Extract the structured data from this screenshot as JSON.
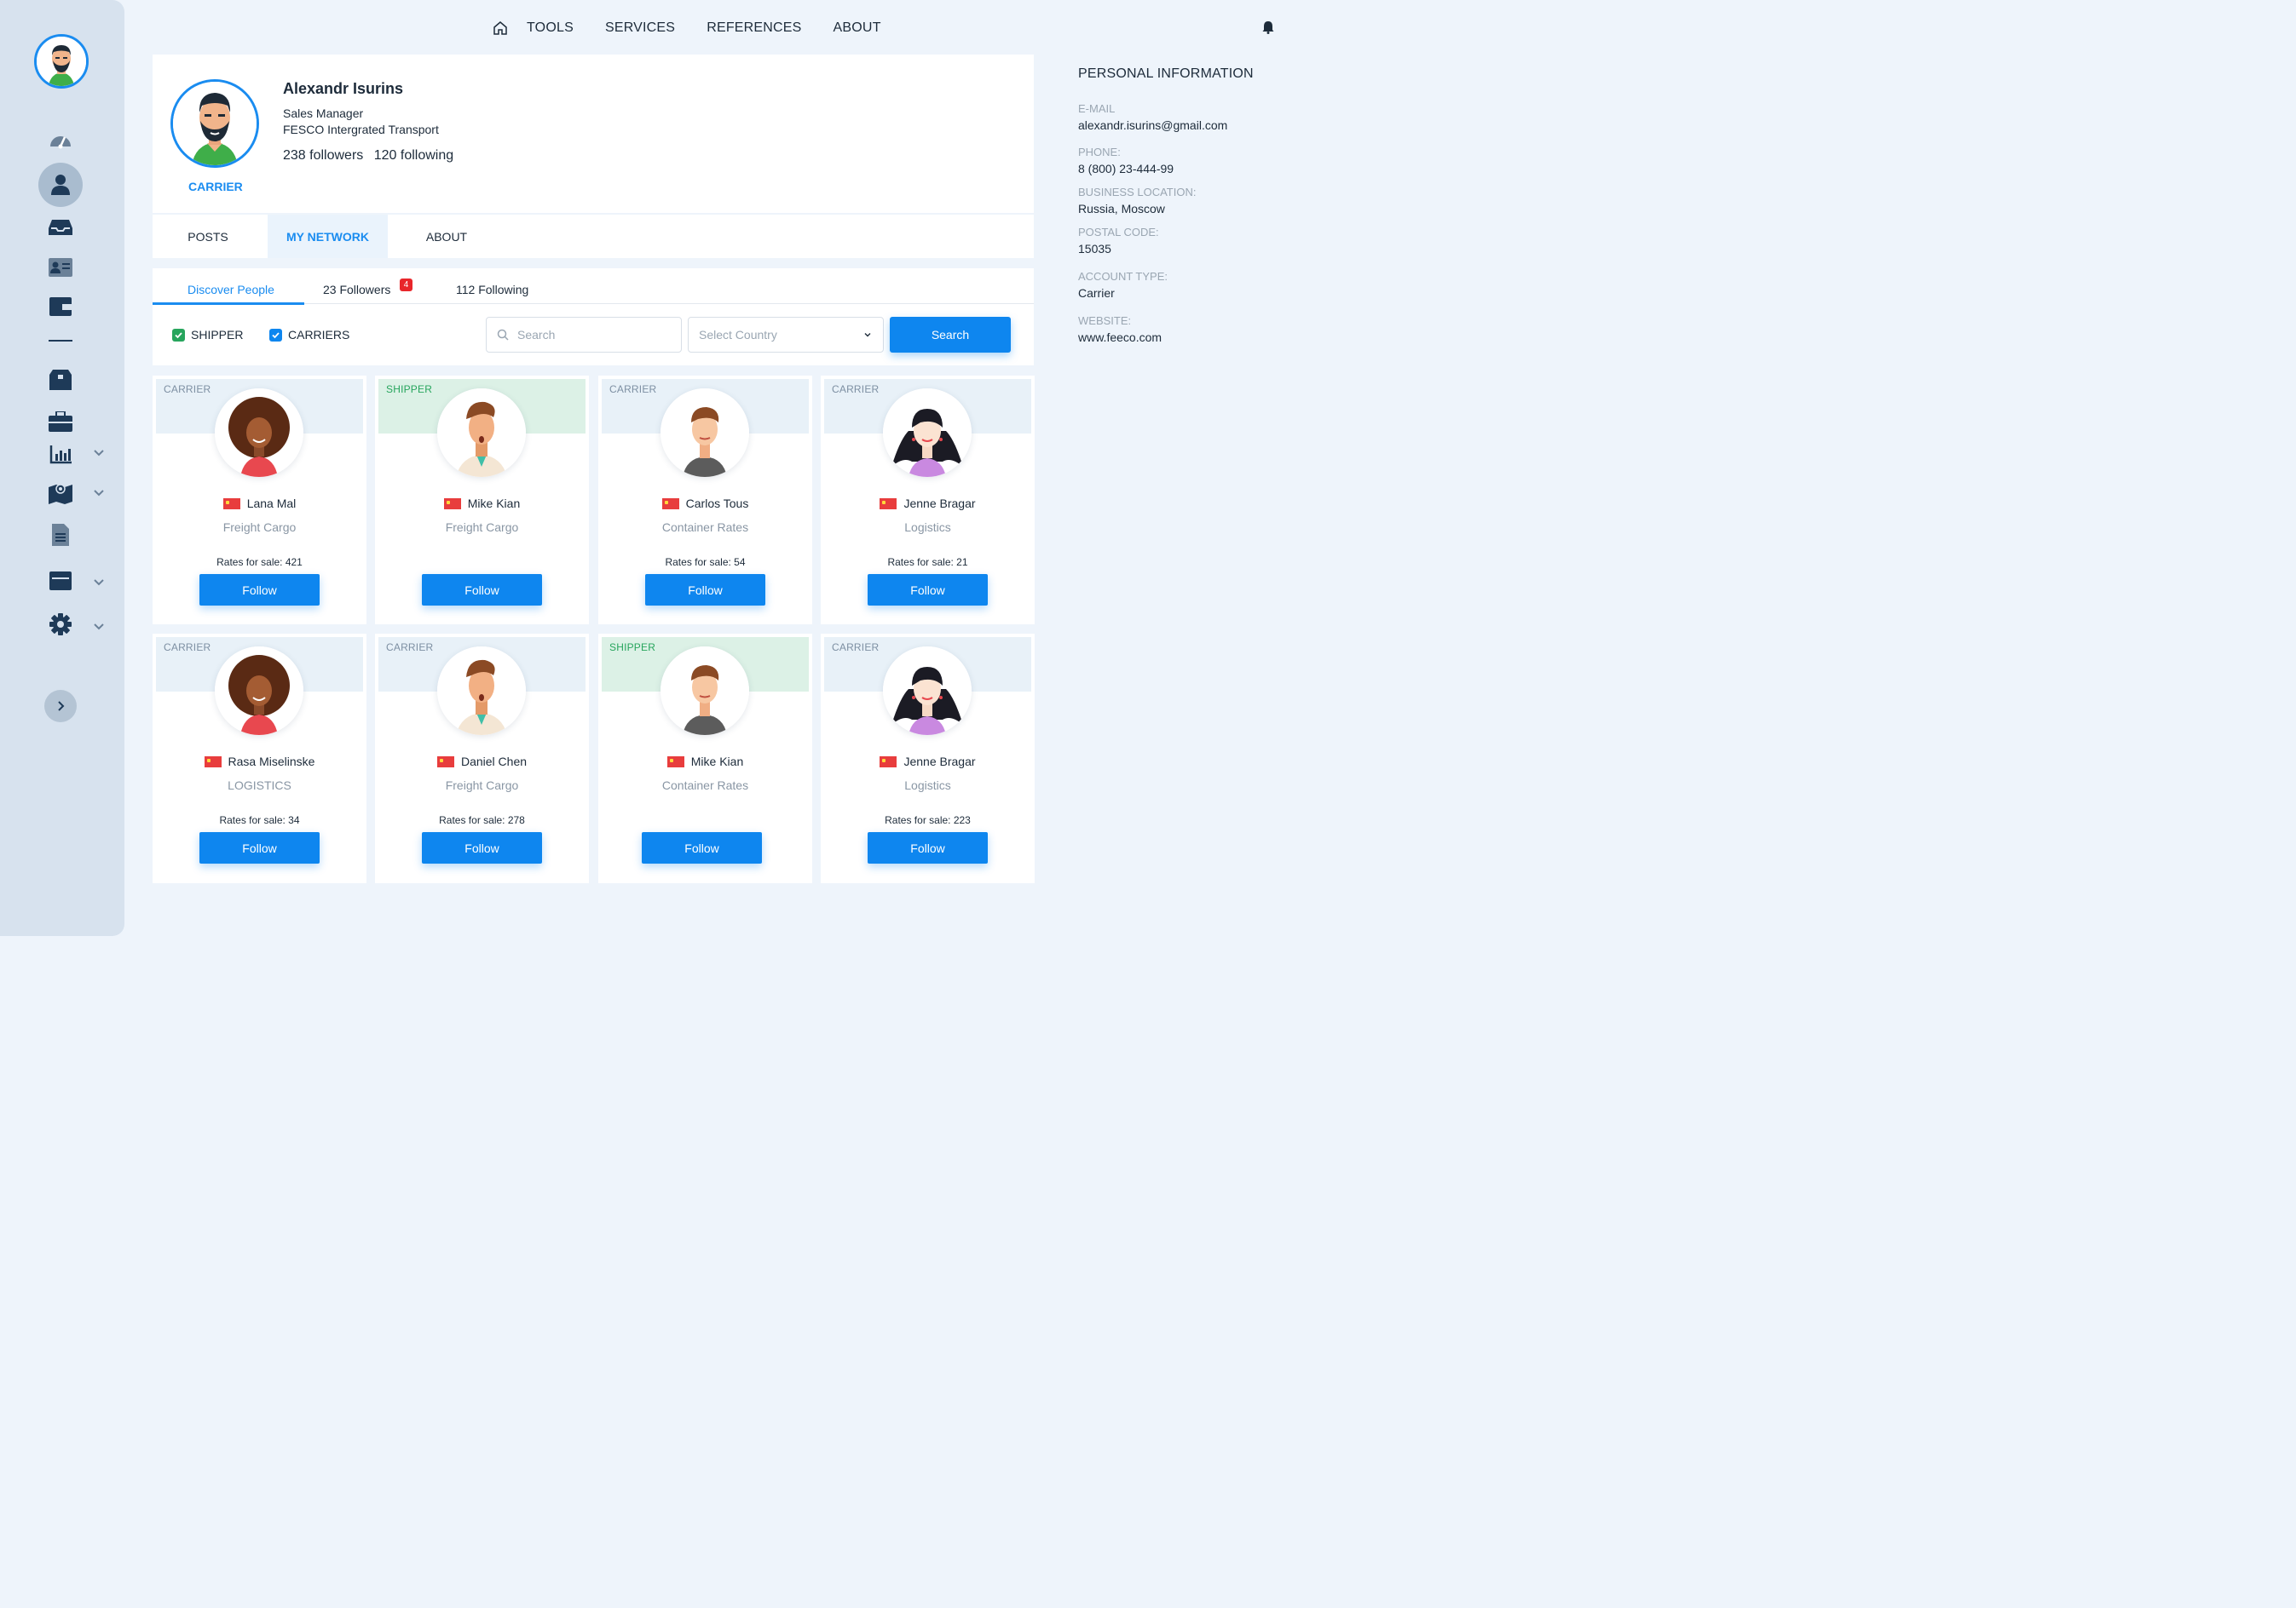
{
  "nav": {
    "links": [
      "TOOLS",
      "SERVICES",
      "REFERENCES",
      "ABOUT"
    ]
  },
  "profile": {
    "name": "Alexandr Isurins",
    "title": "Sales Manager",
    "company": "FESCO Intergrated Transport",
    "followers": "238 followers",
    "following": "120 following",
    "role": "CARRIER"
  },
  "tabs": [
    "POSTS",
    "MY NETWORK",
    "ABOUT"
  ],
  "network": {
    "subtabs": [
      "Discover People",
      "23 Followers",
      "112 Following"
    ],
    "followers_badge": "4",
    "filters": [
      "SHIPPER",
      "CARRIERS"
    ],
    "search_placeholder": "Search",
    "country_placeholder": "Select Country",
    "search_button": "Search"
  },
  "cards": [
    {
      "type": "CARRIER",
      "name": "Lana Mal",
      "category": "Freight Cargo",
      "rates": "Rates for sale: 421",
      "follow": "Follow"
    },
    {
      "type": "SHIPPER",
      "name": "Mike Kian",
      "category": "Freight Cargo",
      "rates": "",
      "follow": "Follow"
    },
    {
      "type": "CARRIER",
      "name": "Carlos Tous",
      "category": "Container Rates",
      "rates": "Rates for sale: 54",
      "follow": "Follow"
    },
    {
      "type": "CARRIER",
      "name": "Jenne Bragar",
      "category": "Logistics",
      "rates": "Rates for sale: 21",
      "follow": "Follow"
    },
    {
      "type": "CARRIER",
      "name": "Rasa Miselinske",
      "category": "LOGISTICS",
      "rates": "Rates for sale: 34",
      "follow": "Follow"
    },
    {
      "type": "CARRIER",
      "name": "Daniel Chen",
      "category": "Freight Cargo",
      "rates": "Rates for sale: 278",
      "follow": "Follow"
    },
    {
      "type": "SHIPPER",
      "name": "Mike Kian",
      "category": "Container Rates",
      "rates": "",
      "follow": "Follow"
    },
    {
      "type": "CARRIER",
      "name": "Jenne Bragar",
      "category": "Logistics",
      "rates": "Rates for sale: 223",
      "follow": "Follow"
    }
  ],
  "personal_info": {
    "title": "PERSONAL INFORMATION",
    "email_label": "E-MAIL",
    "email": "alexandr.isurins@gmail.com",
    "phone_label": "PHONE:",
    "phone": "8 (800) 23-444-99",
    "location_label": "BUSINESS LOCATION:",
    "location": "Russia, Moscow",
    "postal_label": "POSTAL CODE:",
    "postal": "15035",
    "account_label": "ACCOUNT TYPE:",
    "account": "Carrier",
    "website_label": "WEBSITE:",
    "website": "www.feeco.com"
  },
  "colors": {
    "accent": "#0e86ef",
    "sidebar": "#d7e2ee",
    "background": "#eef4fb",
    "shipper": "#27a55d"
  }
}
